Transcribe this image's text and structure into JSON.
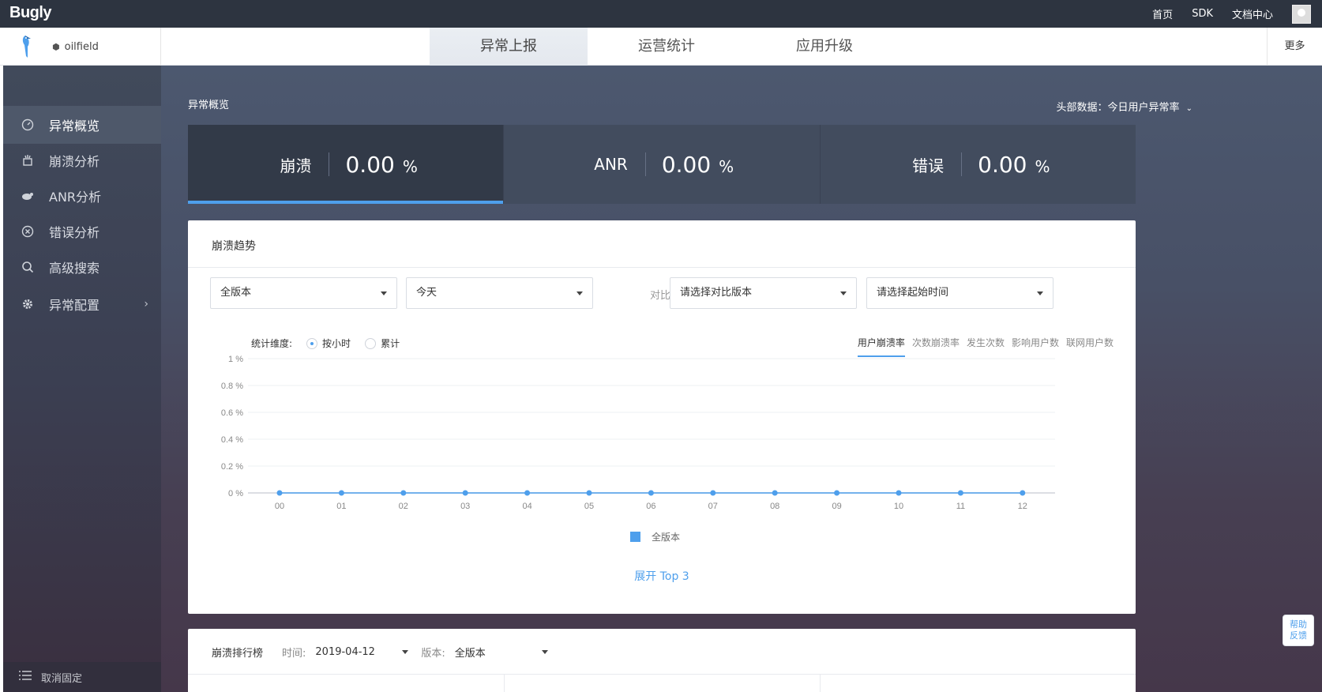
{
  "topbar": {
    "logo": "Bugly",
    "links": [
      "首页",
      "SDK",
      "文档中心"
    ]
  },
  "navbar": {
    "app_name": "oilfield",
    "tabs": [
      "异常上报",
      "运营统计",
      "应用升级"
    ],
    "active_tab": 0,
    "more": "更多"
  },
  "sidebar": {
    "items": [
      {
        "label": "异常概览",
        "icon": "dashboard-icon"
      },
      {
        "label": "崩溃分析",
        "icon": "crash-icon"
      },
      {
        "label": "ANR分析",
        "icon": "anr-icon"
      },
      {
        "label": "错误分析",
        "icon": "error-icon"
      },
      {
        "label": "高级搜索",
        "icon": "search-icon"
      },
      {
        "label": "异常配置",
        "icon": "gear-icon"
      }
    ],
    "unpin": "取消固定"
  },
  "overview": {
    "title": "异常概览",
    "head_data": "头部数据：今日用户异常率",
    "stats": [
      {
        "label": "崩溃",
        "value": "0.00",
        "unit": "%"
      },
      {
        "label": "ANR",
        "value": "0.00",
        "unit": "%"
      },
      {
        "label": "错误",
        "value": "0.00",
        "unit": "%"
      }
    ]
  },
  "trend": {
    "title": "崩溃趋势",
    "version_select": "全版本",
    "date_select": "今天",
    "compare_label": "对比",
    "compare_version_placeholder": "请选择对比版本",
    "compare_time_placeholder": "请选择起始时间",
    "dimension_label": "统计维度:",
    "dimension_options": [
      "按小时",
      "累计"
    ],
    "metrics": [
      "用户崩溃率",
      "次数崩溃率",
      "发生次数",
      "影响用户数",
      "联网用户数"
    ],
    "expand": "展开 Top 3"
  },
  "chart_data": {
    "type": "line",
    "x": [
      "00",
      "01",
      "02",
      "03",
      "04",
      "05",
      "06",
      "07",
      "08",
      "09",
      "10",
      "11",
      "12"
    ],
    "y_ticks": [
      "1 %",
      "0.8 %",
      "0.6 %",
      "0.4 %",
      "0.2 %",
      "0 %"
    ],
    "ylim": [
      0,
      1
    ],
    "series": [
      {
        "name": "全版本",
        "values": [
          0,
          0,
          0,
          0,
          0,
          0,
          0,
          0,
          0,
          0,
          0,
          0,
          0
        ],
        "color": "#4e9fec"
      }
    ],
    "grid": true,
    "legend": "bottom"
  },
  "ranking": {
    "title": "崩溃排行榜",
    "time_label": "时间:",
    "time_value": "2019-04-12",
    "version_label": "版本:",
    "version_value": "全版本"
  },
  "help": [
    "帮助",
    "反馈"
  ],
  "colors": {
    "accent": "#4e9fec",
    "topbar": "#2d3440"
  }
}
